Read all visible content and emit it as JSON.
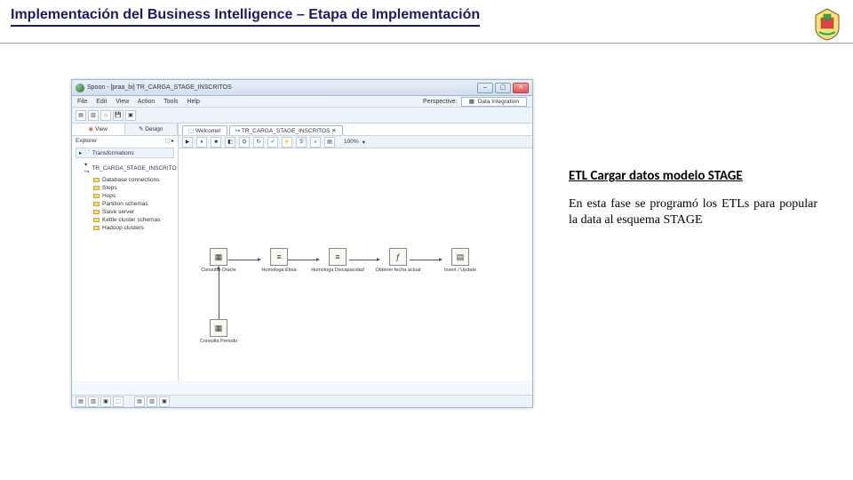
{
  "slide": {
    "title": "Implementación del Business Intelligence – Etapa de Implementación",
    "caption": "ETL Cargar datos modelo STAGE",
    "body": "En esta fase se programó los ETLs para popular la data al esquema STAGE"
  },
  "spoon": {
    "window_title": "Spoon - [praa_bi] TR_CARGA_STAGE_INSCRITOS",
    "menu": [
      "File",
      "Edit",
      "View",
      "Action",
      "Tools",
      "Help"
    ],
    "perspective_label": "Perspective:",
    "perspective_value": "Data Integration",
    "tabs": {
      "welcome": "Welcome!",
      "transform": "TR_CARGA_STAGE_INSCRITOS"
    },
    "sidebar": {
      "view": "View",
      "design": "Design",
      "explorer": "Explorer",
      "tree_header": "Transformations",
      "trans_name": "TR_CARGA_STAGE_INSCRITO",
      "items": [
        "Database connections",
        "Steps",
        "Hops",
        "Partition schemas",
        "Slave server",
        "Kettle cluster schemas",
        "Hadoop clusters"
      ]
    },
    "canvas": {
      "zoom": "100%",
      "steps": [
        {
          "id": "s1",
          "label": "Consulta Oracle",
          "glyph": "▦"
        },
        {
          "id": "s2",
          "label": "Homologa Etnia",
          "glyph": "≡"
        },
        {
          "id": "s3",
          "label": "Homologa Discapacidad",
          "glyph": "≡"
        },
        {
          "id": "s4",
          "label": "Obtener fecha actual",
          "glyph": "ƒ"
        },
        {
          "id": "s5",
          "label": "Insert / Update",
          "glyph": "▤"
        },
        {
          "id": "s6",
          "label": "Consulta Periodo",
          "glyph": "▦"
        }
      ]
    }
  }
}
